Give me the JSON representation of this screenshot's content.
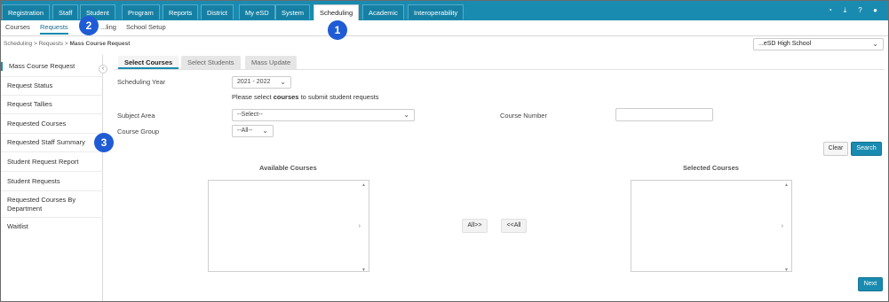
{
  "topnav": {
    "items": [
      "Registration",
      "Staff",
      "Student",
      "Program",
      "Reports",
      "District",
      "My eSD",
      "System",
      "Scheduling",
      "Academic",
      "Interoperability"
    ],
    "active": "Scheduling",
    "icons": [
      "dashboard-icon",
      "download-icon",
      "help-icon",
      "user-icon"
    ]
  },
  "subnav": {
    "items": [
      "Courses",
      "Requests",
      "...ling",
      "School Setup"
    ],
    "active": "Requests"
  },
  "breadcrumb": {
    "part1": "Scheduling",
    "part2": "Requests",
    "current": "Mass Course Request",
    "sep": ">"
  },
  "school_selector": {
    "value": "...eSD High School"
  },
  "sidebar": {
    "items": [
      "Mass Course Request",
      "Request Status",
      "Request Tallies",
      "Requested Courses",
      "Requested Staff Summary",
      "Student Request Report",
      "Student Requests",
      "Requested Courses By Department",
      "Waitlist"
    ]
  },
  "tabs": [
    "Select Courses",
    "Select Students",
    "Mass Update"
  ],
  "form": {
    "year_label": "Scheduling Year",
    "year_value": "2021 - 2022",
    "note_pre": "Please select",
    "note_bold": "courses",
    "note_post": "to submit student requests",
    "subject_label": "Subject Area",
    "subject_value": "--Select--",
    "course_number_label": "Course Number",
    "course_number_value": "",
    "course_group_label": "Course Group",
    "course_group_value": "--All--"
  },
  "buttons": {
    "clear": "Clear",
    "search": "Search",
    "all_right": "All>>",
    "all_left": "<<All",
    "next": "Next"
  },
  "available_courses": {
    "title": "Available Courses"
  },
  "selected_courses": {
    "title": "Selected Courses"
  },
  "callouts": [
    "1",
    "2",
    "3"
  ],
  "colors": {
    "accent": "#1a8bb0",
    "callout": "#1f5bd4"
  }
}
